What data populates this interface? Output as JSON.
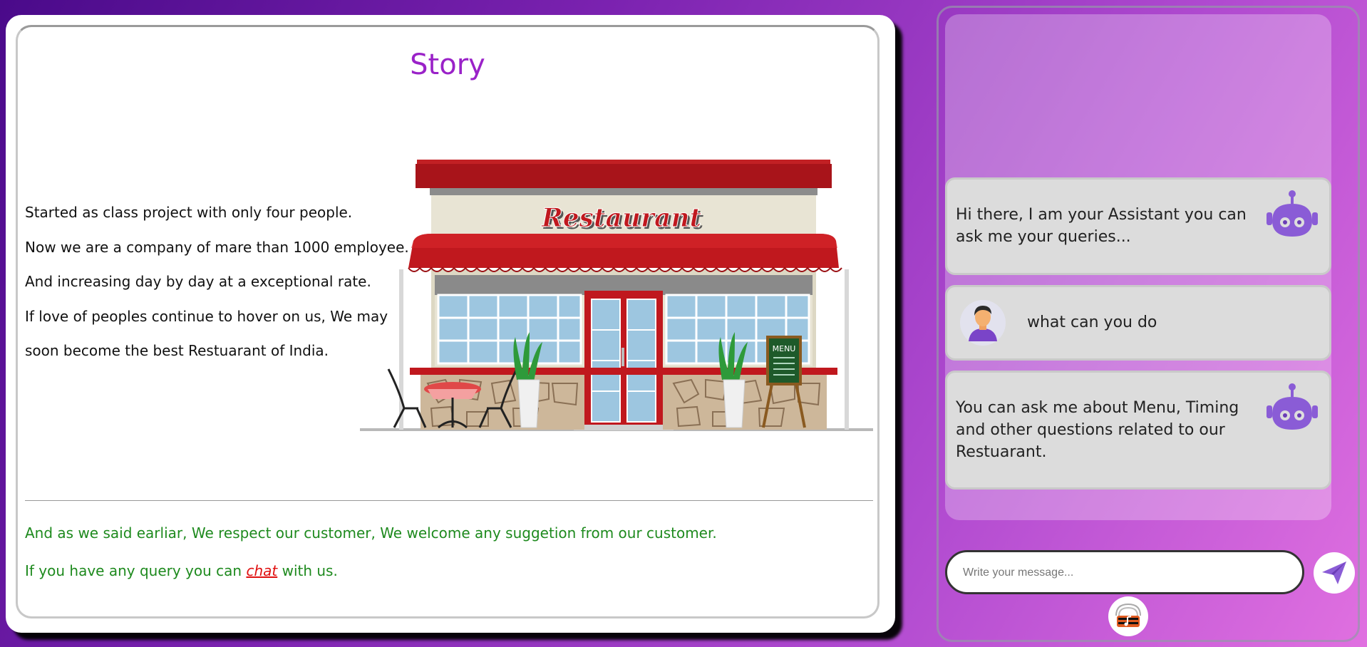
{
  "story": {
    "title": "Story",
    "lines": [
      "Started as class project with only four people.",
      "Now we are a company of mare than 1000 employee.",
      "And increasing day by day at a exceptional rate.",
      "If love of peoples continue to hover on us, We may",
      "soon become the best Restuarant of India."
    ],
    "sign_text": "Restaurant",
    "menu_board_text": "MENU",
    "footer_line1": "And as we said earliar, We respect our customer, We welcome any suggetion from our customer.",
    "footer_line2_before": "If you have any query you can ",
    "footer_link": "chat",
    "footer_line2_after": " with us."
  },
  "chat": {
    "messages": [
      {
        "sender": "bot",
        "text": "Hi there, I am your Assistant you can ask me your queries..."
      },
      {
        "sender": "user",
        "text": "what can you do"
      },
      {
        "sender": "bot",
        "text": "You can ask me about Menu, Timing and other questions related to our Restuarant."
      }
    ],
    "input_placeholder": "Write your message...",
    "input_value": ""
  },
  "icons": {
    "bot": "robot-icon",
    "user": "user-avatar-icon",
    "send": "paper-plane-icon",
    "music": "music-icon"
  },
  "colors": {
    "title": "#9a22c8",
    "footer_text": "#1e8a1e",
    "link": "#e01010",
    "bot_purple": "#8a5cd6"
  }
}
